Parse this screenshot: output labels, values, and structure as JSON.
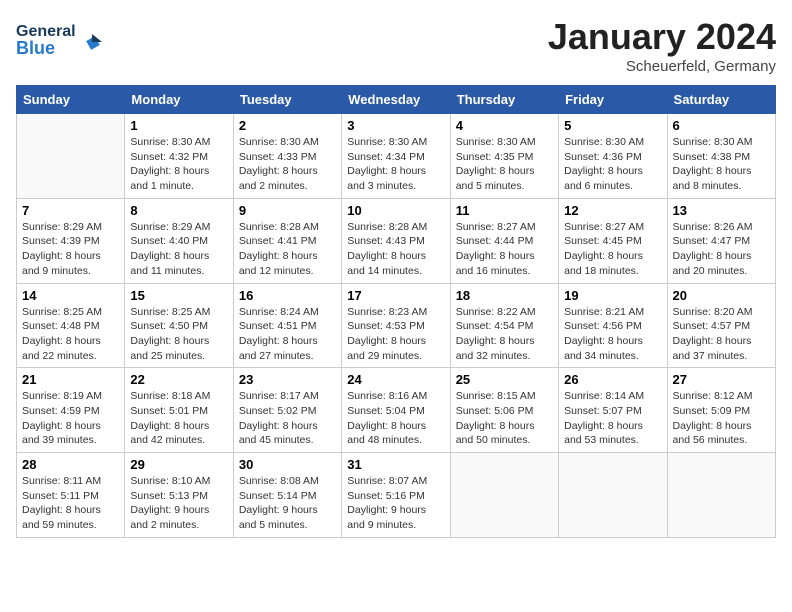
{
  "header": {
    "logo_line1": "General",
    "logo_line2": "Blue",
    "month": "January 2024",
    "location": "Scheuerfeld, Germany"
  },
  "weekdays": [
    "Sunday",
    "Monday",
    "Tuesday",
    "Wednesday",
    "Thursday",
    "Friday",
    "Saturday"
  ],
  "weeks": [
    [
      {
        "day": "",
        "info": ""
      },
      {
        "day": "1",
        "info": "Sunrise: 8:30 AM\nSunset: 4:32 PM\nDaylight: 8 hours\nand 1 minute."
      },
      {
        "day": "2",
        "info": "Sunrise: 8:30 AM\nSunset: 4:33 PM\nDaylight: 8 hours\nand 2 minutes."
      },
      {
        "day": "3",
        "info": "Sunrise: 8:30 AM\nSunset: 4:34 PM\nDaylight: 8 hours\nand 3 minutes."
      },
      {
        "day": "4",
        "info": "Sunrise: 8:30 AM\nSunset: 4:35 PM\nDaylight: 8 hours\nand 5 minutes."
      },
      {
        "day": "5",
        "info": "Sunrise: 8:30 AM\nSunset: 4:36 PM\nDaylight: 8 hours\nand 6 minutes."
      },
      {
        "day": "6",
        "info": "Sunrise: 8:30 AM\nSunset: 4:38 PM\nDaylight: 8 hours\nand 8 minutes."
      }
    ],
    [
      {
        "day": "7",
        "info": "Sunrise: 8:29 AM\nSunset: 4:39 PM\nDaylight: 8 hours\nand 9 minutes."
      },
      {
        "day": "8",
        "info": "Sunrise: 8:29 AM\nSunset: 4:40 PM\nDaylight: 8 hours\nand 11 minutes."
      },
      {
        "day": "9",
        "info": "Sunrise: 8:28 AM\nSunset: 4:41 PM\nDaylight: 8 hours\nand 12 minutes."
      },
      {
        "day": "10",
        "info": "Sunrise: 8:28 AM\nSunset: 4:43 PM\nDaylight: 8 hours\nand 14 minutes."
      },
      {
        "day": "11",
        "info": "Sunrise: 8:27 AM\nSunset: 4:44 PM\nDaylight: 8 hours\nand 16 minutes."
      },
      {
        "day": "12",
        "info": "Sunrise: 8:27 AM\nSunset: 4:45 PM\nDaylight: 8 hours\nand 18 minutes."
      },
      {
        "day": "13",
        "info": "Sunrise: 8:26 AM\nSunset: 4:47 PM\nDaylight: 8 hours\nand 20 minutes."
      }
    ],
    [
      {
        "day": "14",
        "info": "Sunrise: 8:25 AM\nSunset: 4:48 PM\nDaylight: 8 hours\nand 22 minutes."
      },
      {
        "day": "15",
        "info": "Sunrise: 8:25 AM\nSunset: 4:50 PM\nDaylight: 8 hours\nand 25 minutes."
      },
      {
        "day": "16",
        "info": "Sunrise: 8:24 AM\nSunset: 4:51 PM\nDaylight: 8 hours\nand 27 minutes."
      },
      {
        "day": "17",
        "info": "Sunrise: 8:23 AM\nSunset: 4:53 PM\nDaylight: 8 hours\nand 29 minutes."
      },
      {
        "day": "18",
        "info": "Sunrise: 8:22 AM\nSunset: 4:54 PM\nDaylight: 8 hours\nand 32 minutes."
      },
      {
        "day": "19",
        "info": "Sunrise: 8:21 AM\nSunset: 4:56 PM\nDaylight: 8 hours\nand 34 minutes."
      },
      {
        "day": "20",
        "info": "Sunrise: 8:20 AM\nSunset: 4:57 PM\nDaylight: 8 hours\nand 37 minutes."
      }
    ],
    [
      {
        "day": "21",
        "info": "Sunrise: 8:19 AM\nSunset: 4:59 PM\nDaylight: 8 hours\nand 39 minutes."
      },
      {
        "day": "22",
        "info": "Sunrise: 8:18 AM\nSunset: 5:01 PM\nDaylight: 8 hours\nand 42 minutes."
      },
      {
        "day": "23",
        "info": "Sunrise: 8:17 AM\nSunset: 5:02 PM\nDaylight: 8 hours\nand 45 minutes."
      },
      {
        "day": "24",
        "info": "Sunrise: 8:16 AM\nSunset: 5:04 PM\nDaylight: 8 hours\nand 48 minutes."
      },
      {
        "day": "25",
        "info": "Sunrise: 8:15 AM\nSunset: 5:06 PM\nDaylight: 8 hours\nand 50 minutes."
      },
      {
        "day": "26",
        "info": "Sunrise: 8:14 AM\nSunset: 5:07 PM\nDaylight: 8 hours\nand 53 minutes."
      },
      {
        "day": "27",
        "info": "Sunrise: 8:12 AM\nSunset: 5:09 PM\nDaylight: 8 hours\nand 56 minutes."
      }
    ],
    [
      {
        "day": "28",
        "info": "Sunrise: 8:11 AM\nSunset: 5:11 PM\nDaylight: 8 hours\nand 59 minutes."
      },
      {
        "day": "29",
        "info": "Sunrise: 8:10 AM\nSunset: 5:13 PM\nDaylight: 9 hours\nand 2 minutes."
      },
      {
        "day": "30",
        "info": "Sunrise: 8:08 AM\nSunset: 5:14 PM\nDaylight: 9 hours\nand 5 minutes."
      },
      {
        "day": "31",
        "info": "Sunrise: 8:07 AM\nSunset: 5:16 PM\nDaylight: 9 hours\nand 9 minutes."
      },
      {
        "day": "",
        "info": ""
      },
      {
        "day": "",
        "info": ""
      },
      {
        "day": "",
        "info": ""
      }
    ]
  ]
}
